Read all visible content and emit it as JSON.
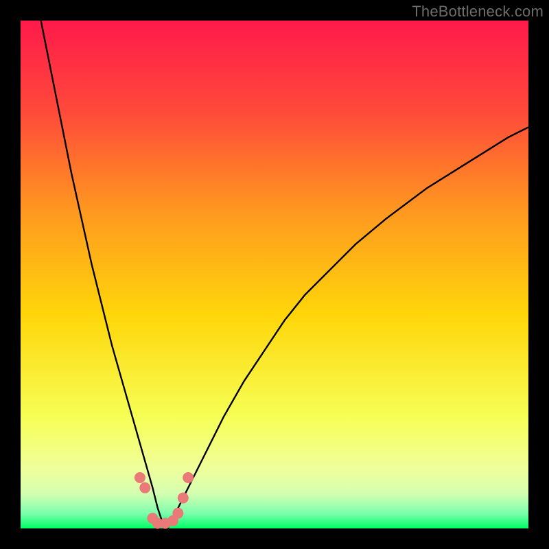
{
  "watermark": "TheBottleneck.com",
  "colors": {
    "top": "#ff1a4b",
    "mid_upper": "#ff7a2a",
    "mid": "#ffd60a",
    "lower": "#f6ff55",
    "pale": "#e4ffb4",
    "bottom": "#00ff66",
    "curve": "#000000",
    "marker": "#e97a78",
    "frame": "#000000"
  },
  "chart_data": {
    "type": "line",
    "title": "",
    "xlabel": "",
    "ylabel": "",
    "xlim": [
      0,
      100
    ],
    "ylim": [
      0,
      100
    ],
    "note": "x is a normalized hardware-capability axis (0–100). y is bottleneck percentage (0 at bottom/green = no bottleneck, 100 at top/red = full bottleneck). Two curves meet near x≈27 at y≈0.",
    "series": [
      {
        "name": "left-curve",
        "x": [
          4,
          6,
          8,
          10,
          12,
          14,
          16,
          18,
          20,
          22,
          24,
          26,
          27,
          28,
          29
        ],
        "y": [
          100,
          90,
          80,
          70,
          61,
          52,
          44,
          36,
          29,
          22,
          15,
          8,
          4,
          1,
          0
        ]
      },
      {
        "name": "right-curve",
        "x": [
          29,
          30,
          32,
          34,
          36,
          38,
          40,
          44,
          48,
          52,
          56,
          60,
          66,
          72,
          80,
          88,
          96,
          100
        ],
        "y": [
          0,
          2,
          6,
          10,
          14,
          18,
          22,
          29,
          35,
          41,
          46,
          50,
          56,
          61,
          67,
          72,
          77,
          79
        ]
      }
    ],
    "markers": {
      "name": "sample-points",
      "color": "#e97a78",
      "points": [
        {
          "x": 23.5,
          "y": 10
        },
        {
          "x": 24.5,
          "y": 8
        },
        {
          "x": 26,
          "y": 2
        },
        {
          "x": 27,
          "y": 1
        },
        {
          "x": 28.5,
          "y": 1
        },
        {
          "x": 30,
          "y": 1.5
        },
        {
          "x": 31,
          "y": 3
        },
        {
          "x": 32,
          "y": 6
        },
        {
          "x": 33,
          "y": 10
        }
      ]
    }
  }
}
